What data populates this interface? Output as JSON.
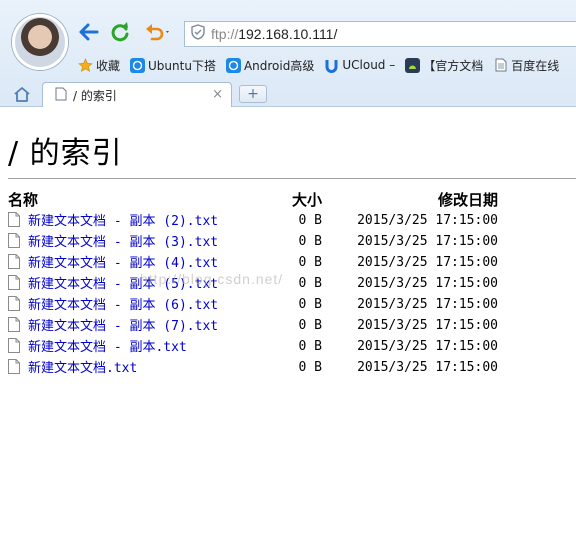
{
  "browser": {
    "address_scheme": "ftp://",
    "address_host": "192.168.10.111/",
    "bookmarks": [
      {
        "label": "收藏",
        "icon": "star-icon",
        "color": "#f2b01e"
      },
      {
        "label": "Ubuntu下搭",
        "icon": "cube-icon",
        "color": "#1e88e5"
      },
      {
        "label": "Android高级",
        "icon": "cube-icon",
        "color": "#1e88e5"
      },
      {
        "label": "UCloud –",
        "icon": "ucloud-icon",
        "color": "#1e6fd9"
      },
      {
        "label": "【官方文档",
        "icon": "android-icon",
        "color": "#2b3a55"
      },
      {
        "label": "百度在线",
        "icon": "page-icon",
        "color": "#6a7a8c"
      }
    ],
    "tab": {
      "title": "/ 的索引",
      "close": "×"
    },
    "new_tab": "+"
  },
  "page": {
    "heading": "/ 的索引",
    "columns": {
      "name": "名称",
      "size": "大小",
      "date": "修改日期"
    },
    "files": [
      {
        "name": "新建文本文档 - 副本 (2).txt",
        "size": "0 B",
        "date": "2015/3/25 17:15:00"
      },
      {
        "name": "新建文本文档 - 副本 (3).txt",
        "size": "0 B",
        "date": "2015/3/25 17:15:00"
      },
      {
        "name": "新建文本文档 - 副本 (4).txt",
        "size": "0 B",
        "date": "2015/3/25 17:15:00"
      },
      {
        "name": "新建文本文档 - 副本 (5).txt",
        "size": "0 B",
        "date": "2015/3/25 17:15:00"
      },
      {
        "name": "新建文本文档 - 副本 (6).txt",
        "size": "0 B",
        "date": "2015/3/25 17:15:00"
      },
      {
        "name": "新建文本文档 - 副本 (7).txt",
        "size": "0 B",
        "date": "2015/3/25 17:15:00"
      },
      {
        "name": "新建文本文档 - 副本.txt",
        "size": "0 B",
        "date": "2015/3/25 17:15:00"
      },
      {
        "name": "新建文本文档.txt",
        "size": "0 B",
        "date": "2015/3/25 17:15:00"
      }
    ],
    "watermark": "http://blog.csdn.net/"
  }
}
